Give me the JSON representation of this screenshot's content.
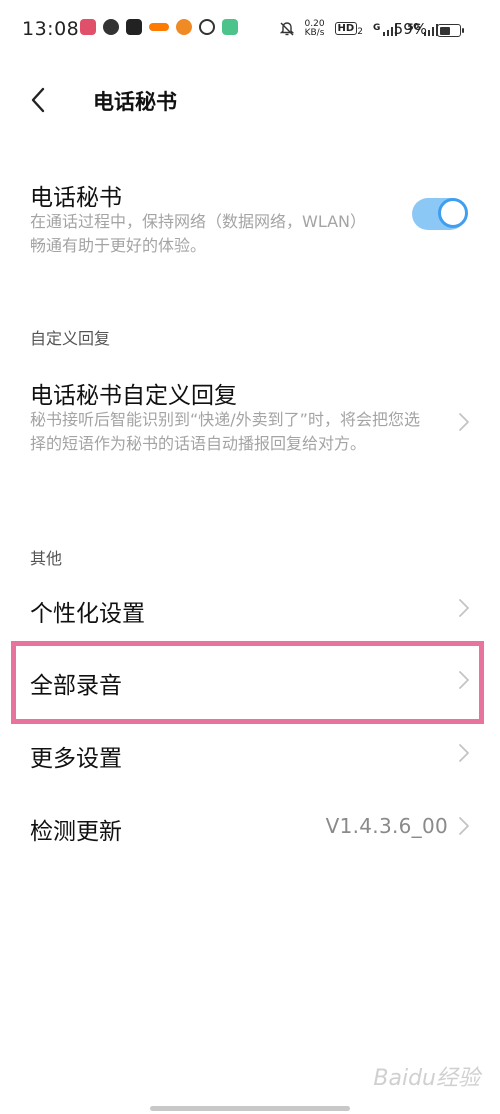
{
  "status_bar": {
    "time": "13:08",
    "net_speed_value": "0.20",
    "net_speed_unit": "KB/s",
    "hd_label": "HD",
    "hd_sub": "2",
    "gen1": "G",
    "gen2": "5G",
    "battery_percent": 59,
    "battery_text": "59%"
  },
  "header": {
    "title": "电话秘书"
  },
  "secretary": {
    "title": "电话秘书",
    "description": "在通话过程中，保持网络（数据网络，WLAN）畅通有助于更好的体验。",
    "enabled": true
  },
  "custom_reply_section": {
    "header": "自定义回复",
    "item_title": "电话秘书自定义回复",
    "item_description": "秘书接听后智能识别到“快递/外卖到了”时，将会把您选择的短语作为秘书的话语自动播报回复给对方。"
  },
  "other_section": {
    "header": "其他",
    "items": [
      {
        "label": "个性化设置"
      },
      {
        "label": "全部录音"
      },
      {
        "label": "更多设置"
      },
      {
        "label": "检测更新",
        "value": "V1.4.3.6_00"
      }
    ]
  },
  "watermark": "Baidu经验",
  "colors": {
    "toggle_track": "#8cc8f5",
    "toggle_knob_border": "#3f9ef0",
    "highlight": "#e8739d",
    "secondary_text": "#a4a4a4"
  }
}
